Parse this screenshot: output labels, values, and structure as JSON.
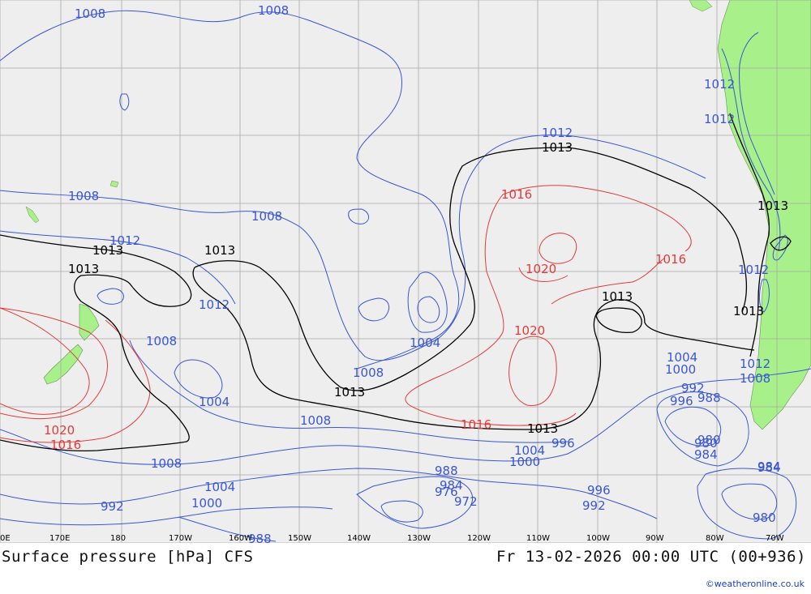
{
  "title": "Surface pressure [hPa] CFS",
  "valid_time": "Fr 13-02-2026 00:00 UTC (00+936)",
  "credit": "©weatheronline.co.uk",
  "colors": {
    "ocean": "#eeeeee",
    "land": "#a8f08a",
    "grid": "#a9a9a9",
    "isobar_low": "#3a56d4",
    "isobar_high": "#e23b3b",
    "isobar_1013": "#000000"
  },
  "longitude_ticks": [
    "0E",
    "170E",
    "180",
    "170W",
    "160W",
    "150W",
    "140W",
    "130W",
    "120W",
    "110W",
    "100W",
    "90W",
    "80W",
    "70W"
  ],
  "isobar_labels": {
    "blue": [
      "1008",
      "1008",
      "1012",
      "1012",
      "1008",
      "1008",
      "1012",
      "1012",
      "1012",
      "1008",
      "1004",
      "1004",
      "1008",
      "1008",
      "1008",
      "1012",
      "1012",
      "1008",
      "1004",
      "1000",
      "1004",
      "1000",
      "988",
      "984",
      "992",
      "996",
      "996",
      "980",
      "984",
      "988",
      "980",
      "976",
      "972",
      "996",
      "992",
      "1004",
      "1000",
      "992",
      "988",
      "984",
      "980",
      "984"
    ],
    "red": [
      "1016",
      "1020",
      "1016",
      "1020",
      "1020",
      "1016",
      "1016"
    ],
    "black": [
      "1013",
      "1013",
      "1013",
      "1013",
      "1013",
      "1013",
      "1013",
      "1013",
      "1013"
    ]
  }
}
